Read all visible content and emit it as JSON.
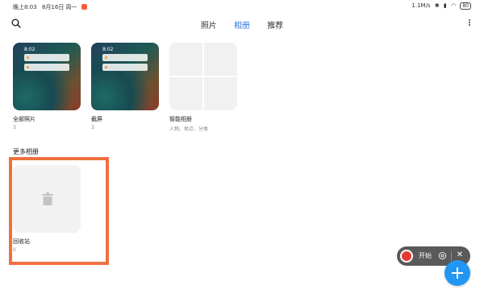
{
  "status_bar": {
    "time": "晚上8:03",
    "date": "8月16日 周一",
    "network_speed": "1.1M/s",
    "battery": "80"
  },
  "header": {
    "tabs": [
      {
        "label": "照片",
        "active": false
      },
      {
        "label": "相册",
        "active": true
      },
      {
        "label": "推荐",
        "active": false
      }
    ],
    "accent_color": "#2b7be6"
  },
  "albums": [
    {
      "name": "全部照片",
      "count": "3",
      "clock": "8:02"
    },
    {
      "name": "截屏",
      "count": "3",
      "clock": "8:02"
    },
    {
      "name": "智能相册",
      "count": "人物、地点、分类"
    }
  ],
  "more_section": {
    "title": "更多相册",
    "albums": [
      {
        "name": "回收站",
        "count": "0",
        "icon": "trash-icon"
      }
    ]
  },
  "recorder": {
    "label": "开始"
  },
  "fab": {
    "icon": "plus-icon",
    "color": "#2196f3"
  }
}
